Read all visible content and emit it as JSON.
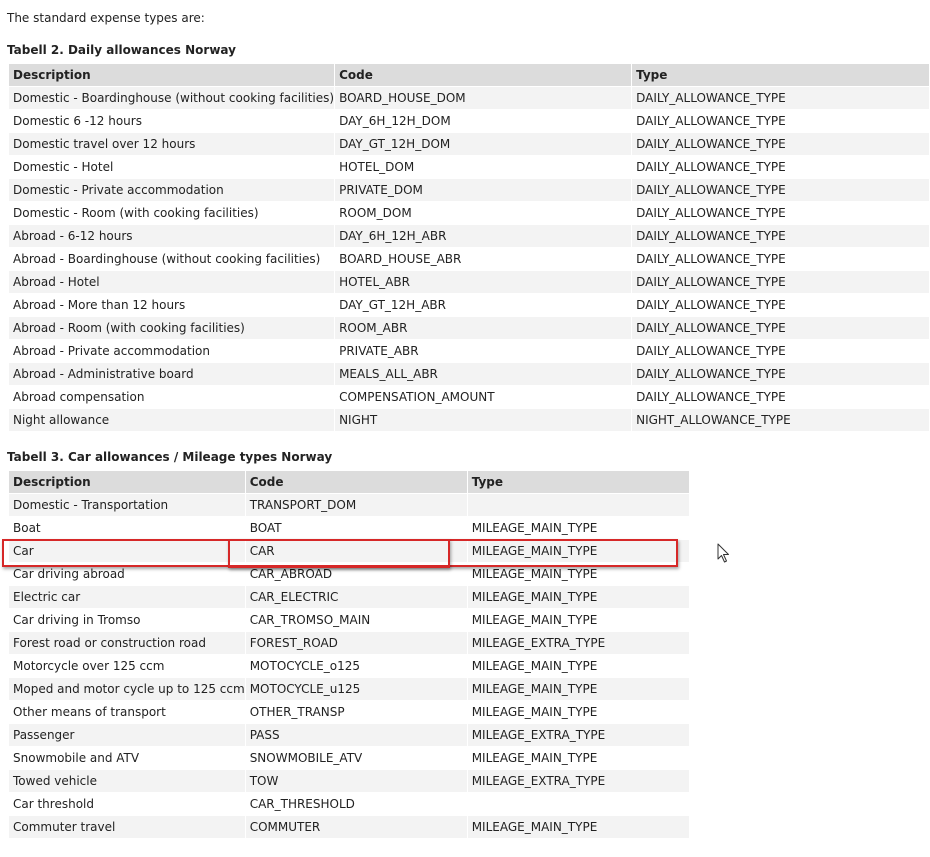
{
  "intro": "The standard expense types are:",
  "table2": {
    "caption": "Tabell 2. Daily allowances Norway",
    "headers": [
      "Description",
      "Code",
      "Type"
    ],
    "rows": [
      [
        "Domestic - Boardinghouse (without cooking facilities)",
        "BOARD_HOUSE_DOM",
        "DAILY_ALLOWANCE_TYPE"
      ],
      [
        "Domestic 6 -12 hours",
        "DAY_6H_12H_DOM",
        "DAILY_ALLOWANCE_TYPE"
      ],
      [
        "Domestic travel over 12 hours",
        "DAY_GT_12H_DOM",
        "DAILY_ALLOWANCE_TYPE"
      ],
      [
        "Domestic - Hotel",
        "HOTEL_DOM",
        "DAILY_ALLOWANCE_TYPE"
      ],
      [
        "Domestic - Private accommodation",
        "PRIVATE_DOM",
        "DAILY_ALLOWANCE_TYPE"
      ],
      [
        "Domestic - Room (with cooking facilities)",
        "ROOM_DOM",
        "DAILY_ALLOWANCE_TYPE"
      ],
      [
        "Abroad - 6-12 hours",
        "DAY_6H_12H_ABR",
        "DAILY_ALLOWANCE_TYPE"
      ],
      [
        "Abroad - Boardinghouse (without cooking facilities)",
        "BOARD_HOUSE_ABR",
        "DAILY_ALLOWANCE_TYPE"
      ],
      [
        "Abroad - Hotel",
        "HOTEL_ABR",
        "DAILY_ALLOWANCE_TYPE"
      ],
      [
        "Abroad - More than 12 hours",
        "DAY_GT_12H_ABR",
        "DAILY_ALLOWANCE_TYPE"
      ],
      [
        "Abroad - Room (with cooking facilities)",
        "ROOM_ABR",
        "DAILY_ALLOWANCE_TYPE"
      ],
      [
        "Abroad - Private accommodation",
        "PRIVATE_ABR",
        "DAILY_ALLOWANCE_TYPE"
      ],
      [
        "Abroad - Administrative board",
        "MEALS_ALL_ABR",
        "DAILY_ALLOWANCE_TYPE"
      ],
      [
        "Abroad compensation",
        "COMPENSATION_AMOUNT",
        "DAILY_ALLOWANCE_TYPE"
      ],
      [
        "Night allowance",
        "NIGHT",
        "NIGHT_ALLOWANCE_TYPE"
      ]
    ]
  },
  "table3": {
    "caption": "Tabell 3. Car allowances / Mileage types Norway",
    "headers": [
      "Description",
      "Code",
      "Type"
    ],
    "rows": [
      [
        "Domestic - Transportation",
        "TRANSPORT_DOM",
        ""
      ],
      [
        "Boat",
        "BOAT",
        "MILEAGE_MAIN_TYPE"
      ],
      [
        "Car",
        "CAR",
        "MILEAGE_MAIN_TYPE"
      ],
      [
        "Car driving abroad",
        "CAR_ABROAD",
        "MILEAGE_MAIN_TYPE"
      ],
      [
        "Electric car",
        "CAR_ELECTRIC",
        "MILEAGE_MAIN_TYPE"
      ],
      [
        "Car driving in Tromso",
        "CAR_TROMSO_MAIN",
        "MILEAGE_MAIN_TYPE"
      ],
      [
        "Forest road or construction road",
        "FOREST_ROAD",
        "MILEAGE_EXTRA_TYPE"
      ],
      [
        "Motorcycle over 125 ccm",
        "MOTOCYCLE_o125",
        "MILEAGE_MAIN_TYPE"
      ],
      [
        "Moped and motor cycle up to 125 ccm",
        "MOTOCYCLE_u125",
        "MILEAGE_MAIN_TYPE"
      ],
      [
        "Other means of transport",
        "OTHER_TRANSP",
        "MILEAGE_MAIN_TYPE"
      ],
      [
        "Passenger",
        "PASS",
        "MILEAGE_EXTRA_TYPE"
      ],
      [
        "Snowmobile and ATV",
        "SNOWMOBILE_ATV",
        "MILEAGE_MAIN_TYPE"
      ],
      [
        "Towed vehicle",
        "TOW",
        "MILEAGE_EXTRA_TYPE"
      ],
      [
        "Car threshold",
        "CAR_THRESHOLD",
        ""
      ],
      [
        "Commuter travel",
        "COMMUTER",
        "MILEAGE_MAIN_TYPE"
      ]
    ]
  },
  "highlight_color": "#d62828",
  "cursor_icon": "mouse-pointer-icon"
}
